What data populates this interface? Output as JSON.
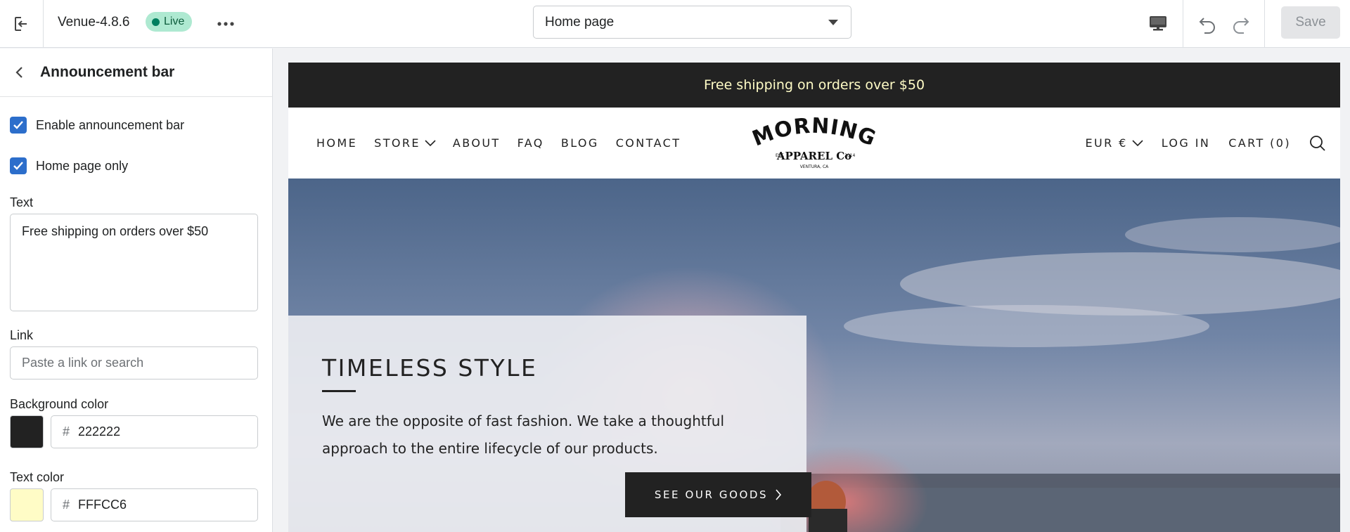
{
  "topbar": {
    "theme_name": "Venue-4.8.6",
    "status": "Live",
    "more": "•••",
    "page_selector": {
      "value": "Home page"
    },
    "save_label": "Save"
  },
  "sidebar": {
    "title": "Announcement bar",
    "enable_label": "Enable announcement bar",
    "home_only_label": "Home page only",
    "text_label": "Text",
    "text_value": "Free shipping on orders over $50",
    "link_label": "Link",
    "link_placeholder": "Paste a link or search",
    "bg_color_label": "Background color",
    "bg_color_value": "222222",
    "text_color_label": "Text color",
    "text_color_value": "FFFCC6"
  },
  "colors": {
    "announcement_bg": "#222222",
    "announcement_text": "#FFFCC6",
    "accent_checkbox": "#2c6ecb"
  },
  "preview": {
    "announcement_text": "Free shipping on orders over $50",
    "nav_left": [
      "HOME",
      "STORE",
      "ABOUT",
      "FAQ",
      "BLOG",
      "CONTACT"
    ],
    "currency": "EUR €",
    "login": "LOG IN",
    "cart": "CART (0)",
    "logo": {
      "line1": "MORNING",
      "line2": "APPAREL Co",
      "est": "EST.",
      "year": "2014",
      "location": "VENTURA, CA"
    },
    "hero": {
      "title": "TIMELESS STYLE",
      "text": "We are the opposite of fast fashion. We take a thoughtful approach to the entire lifecycle of our products.",
      "button": "SEE OUR GOODS"
    }
  }
}
